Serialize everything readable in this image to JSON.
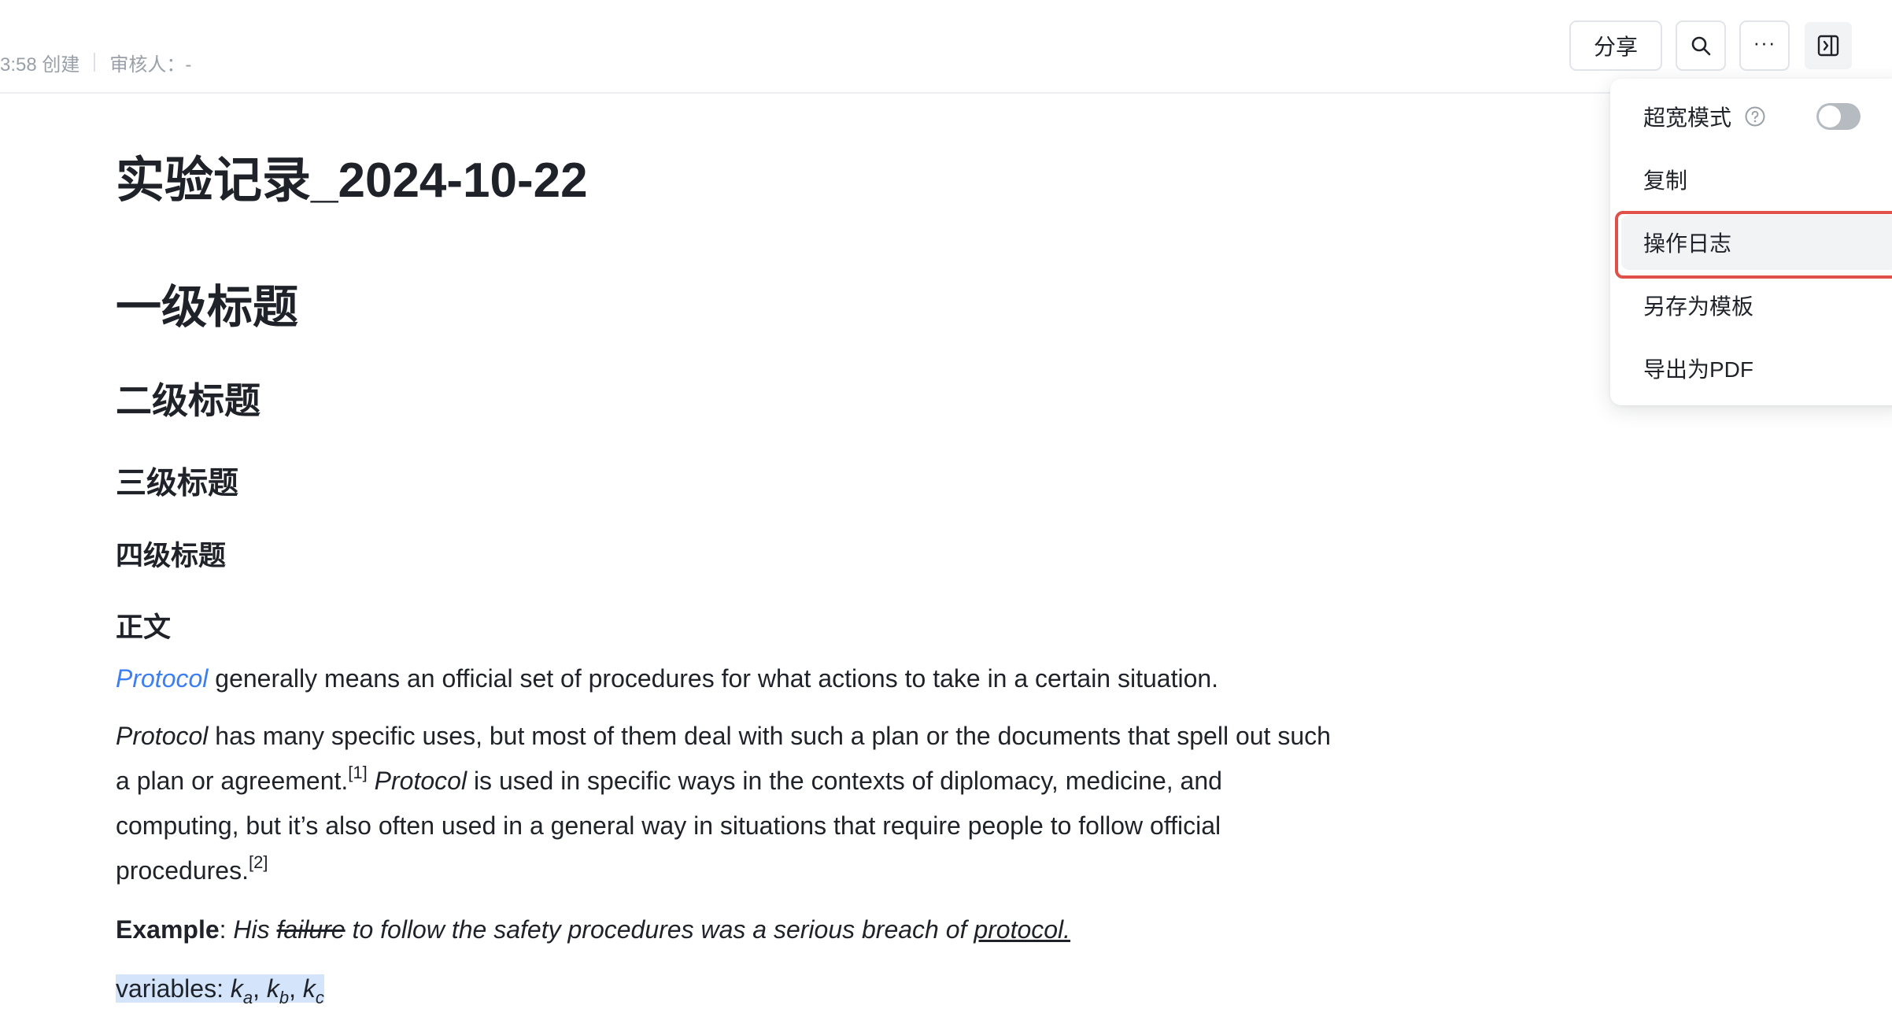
{
  "header": {
    "created_text": "3:58 创建",
    "reviewer_text": "审核人：-",
    "share_label": "分享",
    "more_label": "···",
    "search_icon": "search-icon",
    "panel_icon": "panel-toggle-icon"
  },
  "doc": {
    "title": "实验记录_2024-10-22",
    "h1": "一级标题",
    "h2": "二级标题",
    "h3": "三级标题",
    "h4": "四级标题",
    "body_heading": "正文",
    "p1": {
      "link": "Protocol",
      "rest": " generally means an official set of procedures for what actions to take in a certain situation."
    },
    "p2": {
      "italic1": "Protocol",
      "text1": " has many specific uses, but most of them deal with such a plan or the documents that spell out such a plan or agreement.",
      "ref1": "[1]",
      "italic2": " Protocol",
      "text2": " is used in specific ways in the contexts of diplomacy, medicine, and computing, but it’s also often used in a general way in situations that require people to follow official procedures.",
      "ref2": "[2]"
    },
    "p3": {
      "bold": "Example",
      "colon": ": ",
      "italic_a": "His ",
      "struck": "failure",
      "italic_b": " to follow the safety procedures was a serious breach of ",
      "underlined": "protocol."
    },
    "p4": {
      "label": "variables: ",
      "k": "k",
      "sub_a": "a",
      "sub_b": "b",
      "sub_c": "c",
      "sep": ", "
    }
  },
  "menu": {
    "wide_mode": "超宽模式",
    "wide_mode_enabled": false,
    "copy": "复制",
    "log": "操作日志",
    "save_template": "另存为模板",
    "export_pdf": "导出为PDF"
  },
  "colors": {
    "link": "#3c7ef3",
    "highlight_box": "#e0514a",
    "selection": "#d3e4fb"
  }
}
